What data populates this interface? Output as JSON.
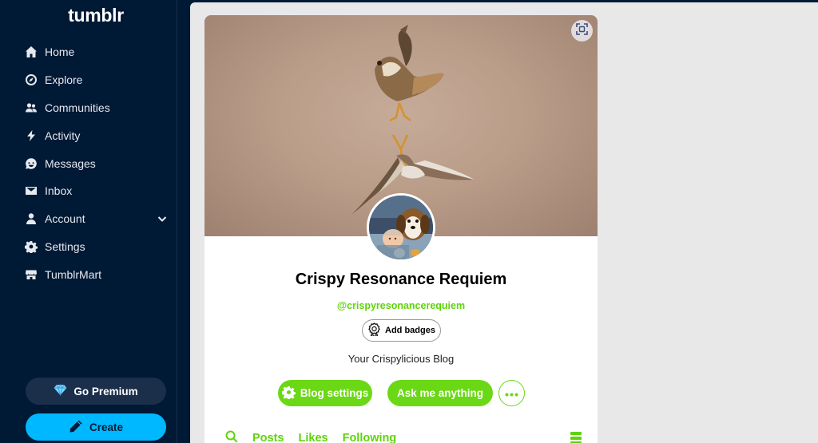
{
  "app": {
    "logo": "tumblr"
  },
  "sidebar": {
    "items": [
      {
        "label": "Home",
        "icon": "home-icon"
      },
      {
        "label": "Explore",
        "icon": "compass-icon"
      },
      {
        "label": "Communities",
        "icon": "people-icon"
      },
      {
        "label": "Activity",
        "icon": "lightning-icon"
      },
      {
        "label": "Messages",
        "icon": "chat-smile-icon"
      },
      {
        "label": "Inbox",
        "icon": "envelope-icon"
      },
      {
        "label": "Account",
        "icon": "person-icon"
      },
      {
        "label": "Settings",
        "icon": "gear-icon"
      },
      {
        "label": "TumblrMart",
        "icon": "store-icon"
      }
    ],
    "premium_label": "Go Premium",
    "create_label": "Create"
  },
  "blog": {
    "title": "Crispy Resonance Requiem",
    "handle": "@crispyresonancerequiem",
    "badges_label": "Add badges",
    "description": "Your Crispylicious Blog",
    "settings_label": "Blog settings",
    "ask_label": "Ask me anything"
  },
  "tabs": [
    "Posts",
    "Likes",
    "Following"
  ],
  "colors": {
    "sidebar_bg": "#001935",
    "accent_green": "#6bd816",
    "create_blue": "#00b8ff",
    "premium_bg": "#1b2f4b"
  }
}
